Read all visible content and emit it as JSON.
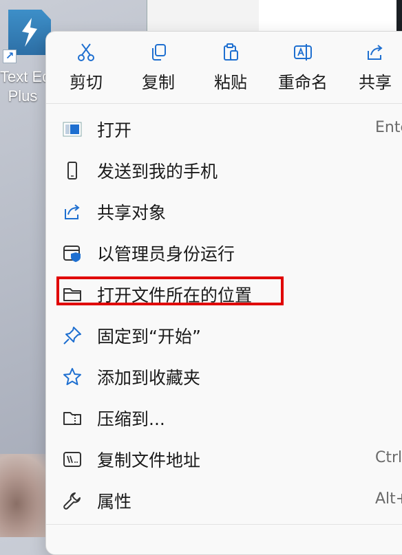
{
  "desktop": {
    "shortcut": {
      "label_line1": "Text Ed",
      "label_line2": "Plus",
      "icon": "text-editor-app-icon",
      "overlay_icon": "shortcut-arrow-icon"
    }
  },
  "menu": {
    "quick_actions": [
      {
        "label": "剪切",
        "icon": "cut-icon"
      },
      {
        "label": "复制",
        "icon": "copy-icon"
      },
      {
        "label": "粘贴",
        "icon": "paste-icon"
      },
      {
        "label": "重命名",
        "icon": "rename-icon"
      },
      {
        "label": "共享",
        "icon": "share-icon"
      }
    ],
    "items": [
      {
        "label": "打开",
        "icon": "app-window-icon",
        "shortcut": "Ente"
      },
      {
        "label": "发送到我的手机",
        "icon": "phone-icon",
        "shortcut": ""
      },
      {
        "label": "共享对象",
        "icon": "share-icon",
        "shortcut": ""
      },
      {
        "label": "以管理员身份运行",
        "icon": "admin-shield-icon",
        "shortcut": ""
      },
      {
        "label": "打开文件所在的位置",
        "icon": "folder-icon",
        "shortcut": ""
      },
      {
        "label": "固定到“开始”",
        "icon": "pin-icon",
        "shortcut": ""
      },
      {
        "label": "添加到收藏夹",
        "icon": "star-icon",
        "shortcut": ""
      },
      {
        "label": "压缩到...",
        "icon": "zip-folder-icon",
        "shortcut": ""
      },
      {
        "label": "复制文件地址",
        "icon": "copy-path-icon",
        "shortcut": "Ctrl"
      },
      {
        "label": "属性",
        "icon": "wrench-icon",
        "shortcut": "Alt+"
      }
    ]
  },
  "colors": {
    "accent": "#1e6fd0",
    "highlight_border": "#e00000",
    "menu_bg": "#f9f9f9"
  }
}
